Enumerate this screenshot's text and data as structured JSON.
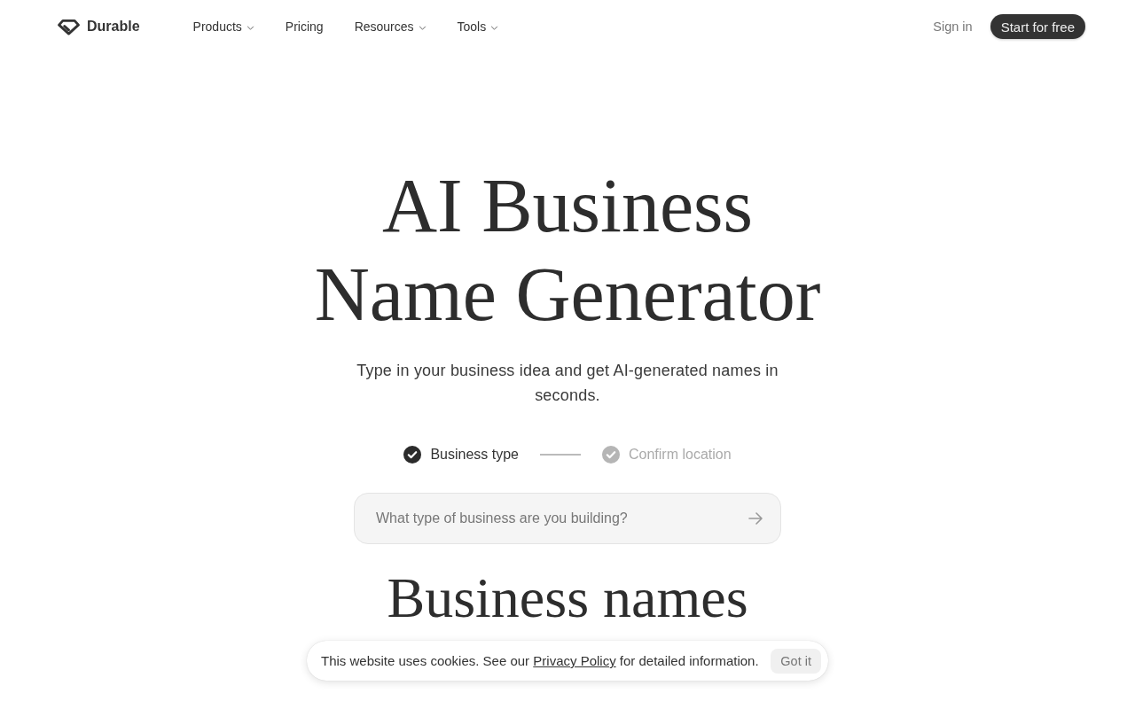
{
  "header": {
    "brand": "Durable",
    "nav": [
      {
        "label": "Products",
        "has_menu": true
      },
      {
        "label": "Pricing",
        "has_menu": false
      },
      {
        "label": "Resources",
        "has_menu": true
      },
      {
        "label": "Tools",
        "has_menu": true
      }
    ],
    "sign_in": "Sign in",
    "cta": "Start for free"
  },
  "hero": {
    "title": "AI Business Name Generator",
    "subtitle": "Type in your business idea and get AI-generated names in seconds.",
    "steps": [
      {
        "label": "Business type",
        "active": true
      },
      {
        "label": "Confirm location",
        "active": false
      }
    ],
    "input": {
      "placeholder": "What type of business are you building?"
    }
  },
  "next_section": {
    "title": "Business names"
  },
  "cookie_banner": {
    "text_before": "This website uses cookies. See our",
    "link": "Privacy Policy",
    "text_after": "for detailed information.",
    "button": "Got it"
  }
}
